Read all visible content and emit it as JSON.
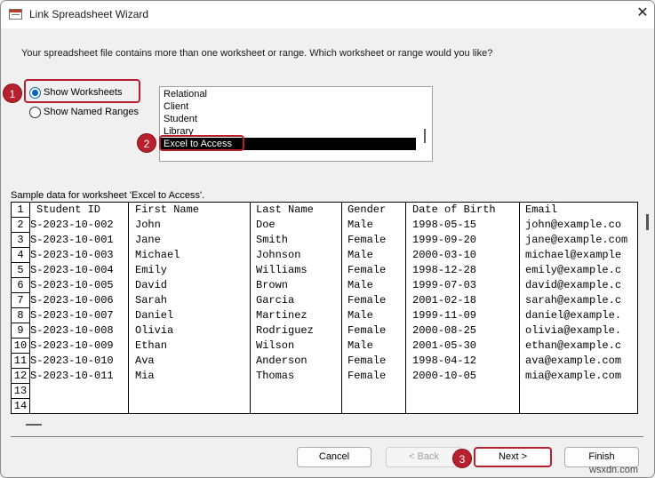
{
  "window": {
    "title": "Link Spreadsheet Wizard",
    "close_glyph": "✕"
  },
  "prompt": "Your spreadsheet file contains more than one worksheet or range. Which worksheet or range would you like?",
  "options": [
    {
      "label": "Show Worksheets",
      "selected": true
    },
    {
      "label": "Show Named Ranges",
      "selected": false
    }
  ],
  "worksheets": [
    "Relational",
    "Client",
    "Student",
    "Library",
    "Excel to Access"
  ],
  "selected_worksheet": "Excel to Access",
  "sample_label": "Sample data for worksheet 'Excel to Access'.",
  "table": {
    "row_numbers": [
      "1",
      "2",
      "3",
      "4",
      "5",
      "6",
      "7",
      "8",
      "9",
      "10",
      "11",
      "12",
      "13",
      "14"
    ],
    "header": [
      "Student ID",
      "First Name",
      "Last Name",
      "Gender",
      "Date of Birth",
      "Email"
    ],
    "rows": [
      [
        "S-2023-10-002",
        "John",
        "Doe",
        "Male",
        "1998-05-15",
        "john@example.co"
      ],
      [
        "S-2023-10-001",
        "Jane",
        "Smith",
        "Female",
        "1999-09-20",
        "jane@example.com"
      ],
      [
        "S-2023-10-003",
        "Michael",
        "Johnson",
        "Male",
        "2000-03-10",
        "michael@example"
      ],
      [
        "S-2023-10-004",
        "Emily",
        "Williams",
        "Female",
        "1998-12-28",
        "emily@example.c"
      ],
      [
        "S-2023-10-005",
        "David",
        "Brown",
        "Male",
        "1999-07-03",
        "david@example.c"
      ],
      [
        "S-2023-10-006",
        "Sarah",
        "Garcia",
        "Female",
        "2001-02-18",
        "sarah@example.c"
      ],
      [
        "S-2023-10-007",
        "Daniel",
        "Martinez",
        "Male",
        "1999-11-09",
        "daniel@example."
      ],
      [
        "S-2023-10-008",
        "Olivia",
        "Rodriguez",
        "Female",
        "2000-08-25",
        "olivia@example."
      ],
      [
        "S-2023-10-009",
        "Ethan",
        "Wilson",
        "Male",
        "2001-05-30",
        "ethan@example.c"
      ],
      [
        "S-2023-10-010",
        "Ava",
        "Anderson",
        "Female",
        "1998-04-12",
        "ava@example.com"
      ],
      [
        "S-2023-10-011",
        "Mia",
        "Thomas",
        "Female",
        "2000-10-05",
        "mia@example.com"
      ]
    ]
  },
  "buttons": {
    "cancel": "Cancel",
    "back": "< Back",
    "next": "Next >",
    "finish": "Finish"
  },
  "badges": [
    "1",
    "2",
    "3"
  ],
  "accent_color": "#b8202e",
  "watermark": "wsxdn.com"
}
